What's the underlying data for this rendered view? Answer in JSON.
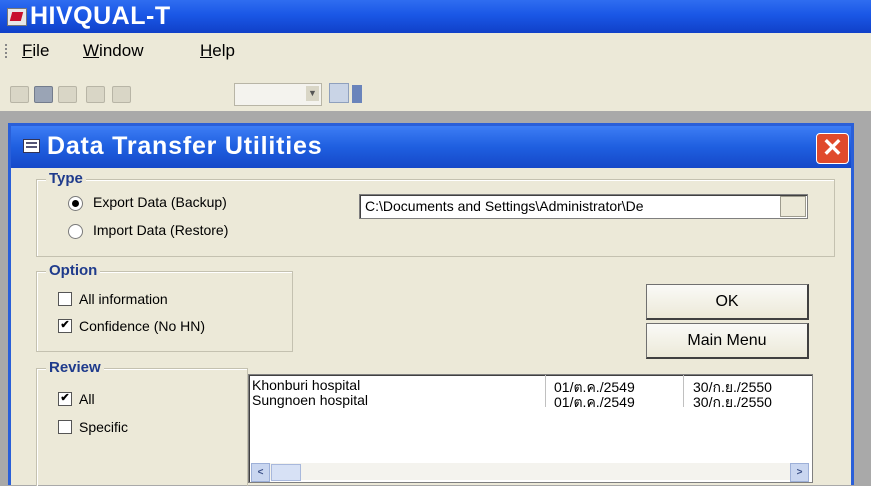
{
  "app": {
    "title": "HIVQUAL-T",
    "menu": {
      "file_mn": "F",
      "file_rest": "ile",
      "window_mn": "W",
      "window_rest": "indow",
      "help_mn": "H",
      "help_rest": "elp"
    }
  },
  "toolbar": {
    "icons": [
      "folder-icon",
      "printer-icon",
      "window-icon",
      "window-icon",
      "grid-icon",
      "edit-icon"
    ],
    "combo_value": ""
  },
  "dialog": {
    "title": "Data Transfer Utilities",
    "close_glyph": "✕",
    "type_group": {
      "label": "Type",
      "export_label": "Export Data (Backup)",
      "export_selected": true,
      "import_label": "Import Data (Restore)",
      "path_value": "C:\\Documents and Settings\\Administrator\\De"
    },
    "option_group": {
      "label": "Option",
      "all_info_label": "All information",
      "all_info_checked": false,
      "confidence_label": "Confidence (No HN)",
      "confidence_checked": true
    },
    "review_group": {
      "label": "Review",
      "all_label": "All",
      "all_checked": true,
      "specific_label": "Specific",
      "specific_checked": false
    },
    "buttons": {
      "ok": "OK",
      "main_menu": "Main Menu"
    },
    "list": [
      {
        "name": "Khonburi hospital",
        "start": "01/ต.ค./2549",
        "end": "30/ก.ย./2550"
      },
      {
        "name": "Sungnoen hospital",
        "start": "01/ต.ค./2549",
        "end": "30/ก.ย./2550"
      }
    ],
    "scroll": {
      "left": "<",
      "right": ">"
    },
    "check_glyph": "✔"
  }
}
